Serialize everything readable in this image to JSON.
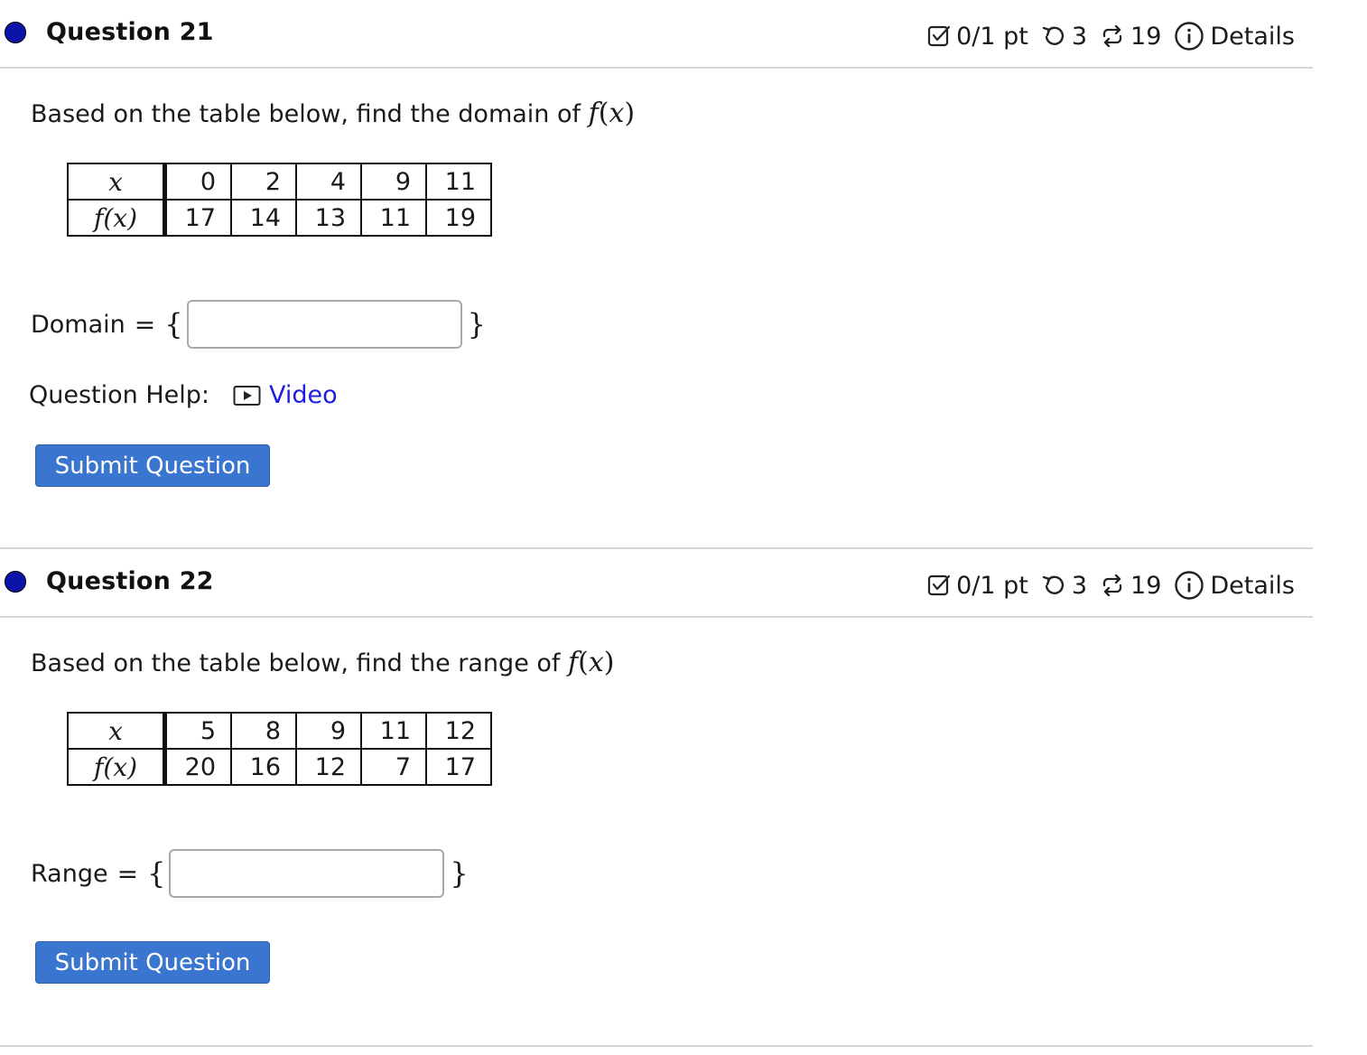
{
  "questions": [
    {
      "title": "Question 21",
      "meta": {
        "score": "0/1 pt",
        "retries": "3",
        "attempts": "19",
        "details": "Details"
      },
      "prompt": "Based on the table below, find the domain of",
      "func": "f",
      "var": "x",
      "table": {
        "x_label": "x",
        "fx_label": "f(x)",
        "x_values": [
          "0",
          "2",
          "4",
          "9",
          "11"
        ],
        "fx_values": [
          "17",
          "14",
          "13",
          "11",
          "19"
        ]
      },
      "answer_label": "Domain",
      "answer_value": "",
      "help_label": "Question Help:",
      "help_link": "Video",
      "submit_label": "Submit Question"
    },
    {
      "title": "Question 22",
      "meta": {
        "score": "0/1 pt",
        "retries": "3",
        "attempts": "19",
        "details": "Details"
      },
      "prompt": "Based on the table below, find the range of",
      "func": "f",
      "var": "x",
      "table": {
        "x_label": "x",
        "fx_label": "f(x)",
        "x_values": [
          "5",
          "8",
          "9",
          "11",
          "12"
        ],
        "fx_values": [
          "20",
          "16",
          "12",
          "7",
          "17"
        ]
      },
      "answer_label": "Range",
      "answer_value": "",
      "submit_label": "Submit Question"
    }
  ],
  "colors": {
    "status_dot": "#0a14a8",
    "button": "#3a75cf",
    "link": "#1d1de0",
    "divider": "#d6d6d6"
  },
  "icons": [
    "checkbox-icon",
    "retry-icon",
    "attempts-icon",
    "info-icon",
    "video-icon"
  ]
}
